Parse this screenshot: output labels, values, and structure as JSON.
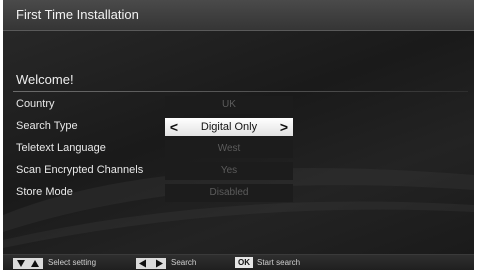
{
  "header": {
    "title": "First Time Installation"
  },
  "section": {
    "heading": "Welcome!"
  },
  "settings": [
    {
      "label": "Country",
      "value": "UK",
      "active": false
    },
    {
      "label": "Search Type",
      "value": "Digital Only",
      "active": true
    },
    {
      "label": "Teletext Language",
      "value": "West",
      "active": false
    },
    {
      "label": "Scan Encrypted Channels",
      "value": "Yes",
      "active": false
    },
    {
      "label": "Store Mode",
      "value": "Disabled",
      "active": false
    }
  ],
  "footer": {
    "select_setting": "Select setting",
    "search": "Search",
    "ok_key": "OK",
    "start_search": "Start search"
  },
  "colors": {
    "active_value_bg": "#ffffff",
    "inactive_value_bg": "#1c1c1c",
    "inactive_value_text": "#5c5c5c"
  },
  "icons": {
    "left_arrow": "left-arrow-icon",
    "right_arrow": "right-arrow-icon",
    "up_down": "up-down-keys-icon",
    "left_right": "left-right-keys-icon",
    "ok": "ok-key-icon"
  }
}
